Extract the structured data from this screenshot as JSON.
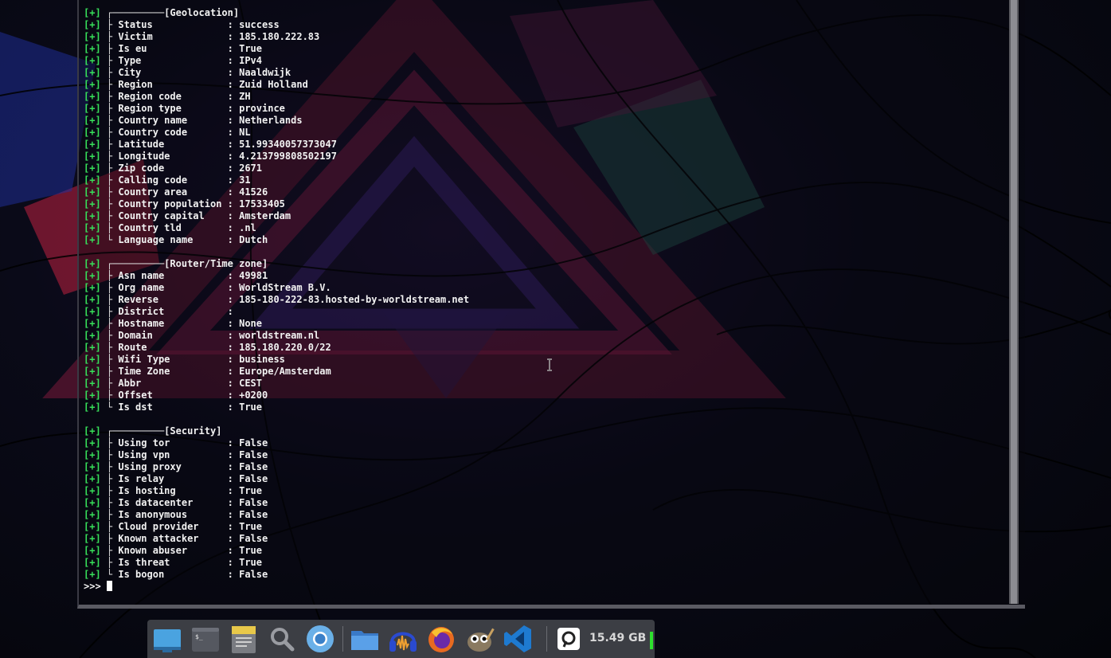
{
  "terminal": {
    "geolocation_header": "[Geolocation]",
    "geolocation": [
      {
        "key": "Status",
        "value": "success"
      },
      {
        "key": "Victim",
        "value": "185.180.222.83"
      },
      {
        "key": "Is eu",
        "value": "True"
      },
      {
        "key": "Type",
        "value": "IPv4"
      },
      {
        "key": "City",
        "value": "Naaldwijk"
      },
      {
        "key": "Region",
        "value": "Zuid Holland"
      },
      {
        "key": "Region code",
        "value": "ZH"
      },
      {
        "key": "Region type",
        "value": "province"
      },
      {
        "key": "Country name",
        "value": "Netherlands"
      },
      {
        "key": "Country code",
        "value": "NL"
      },
      {
        "key": "Latitude",
        "value": "51.99340057373047"
      },
      {
        "key": "Longitude",
        "value": "4.213799808502197"
      },
      {
        "key": "Zip code",
        "value": "2671"
      },
      {
        "key": "Calling code",
        "value": "31"
      },
      {
        "key": "Country area",
        "value": "41526"
      },
      {
        "key": "Country population",
        "value": "17533405"
      },
      {
        "key": "Country capital",
        "value": "Amsterdam"
      },
      {
        "key": "Country tld",
        "value": ".nl"
      },
      {
        "key": "Language name",
        "value": "Dutch"
      }
    ],
    "router_header": "[Router/Time zone]",
    "router": [
      {
        "key": "Asn name",
        "value": "49981"
      },
      {
        "key": "Org name",
        "value": "WorldStream B.V."
      },
      {
        "key": "Reverse",
        "value": "185-180-222-83.hosted-by-worldstream.net"
      },
      {
        "key": "District",
        "value": ""
      },
      {
        "key": "Hostname",
        "value": "None"
      },
      {
        "key": "Domain",
        "value": "worldstream.nl"
      },
      {
        "key": "Route",
        "value": "185.180.220.0/22"
      },
      {
        "key": "Wifi Type",
        "value": "business"
      },
      {
        "key": "Time Zone",
        "value": "Europe/Amsterdam"
      },
      {
        "key": "Abbr",
        "value": "CEST"
      },
      {
        "key": "Offset",
        "value": "+0200"
      },
      {
        "key": "Is dst",
        "value": "True"
      }
    ],
    "security_header": "[Security]",
    "security": [
      {
        "key": "Using tor",
        "value": "False"
      },
      {
        "key": "Using vpn",
        "value": "False"
      },
      {
        "key": "Using proxy",
        "value": "False"
      },
      {
        "key": "Is relay",
        "value": "False"
      },
      {
        "key": "Is hosting",
        "value": "True"
      },
      {
        "key": "Is datacenter",
        "value": "False"
      },
      {
        "key": "Is anonymous",
        "value": "False"
      },
      {
        "key": "Cloud provider",
        "value": "True"
      },
      {
        "key": "Known attacker",
        "value": "False"
      },
      {
        "key": "Known abuser",
        "value": "True"
      },
      {
        "key": "Is threat",
        "value": "True"
      },
      {
        "key": "Is bogon",
        "value": "False"
      }
    ],
    "prompt": ">>> "
  },
  "dock": {
    "icons": [
      "desktop-icon",
      "terminal-icon",
      "text-editor-icon",
      "search-icon",
      "chromium-icon",
      "files-icon",
      "audacity-icon",
      "firefox-icon",
      "gimp-icon",
      "vscode-icon",
      "disk-usage-icon"
    ],
    "disk_label": "15.49 GB",
    "disk_color": "#2ee02e"
  },
  "colors": {
    "tag": "#37e05a",
    "text": "#f2f2f2",
    "dock": "#3c3e44"
  }
}
